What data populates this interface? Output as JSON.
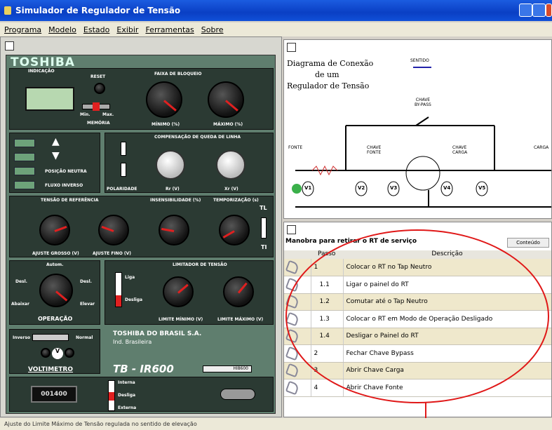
{
  "window": {
    "title": "Simulador de Regulador de Tensão"
  },
  "menu": [
    "Programa",
    "Modelo",
    "Estado",
    "Exibir",
    "Ferramentas",
    "Sobre"
  ],
  "panel": {
    "brand": "TOSHIBA",
    "indicacao": "INDICAÇÃO",
    "reset": "RESET",
    "min": "Min.",
    "max": "Max.",
    "memoria": "MEMÓRIA",
    "faixa": "FAIXA DE BLOQUEIO",
    "minimo": "MÍNIMO (%)",
    "maximo": "MÁXIMO (%)",
    "comp": "COMPENSAÇÃO DE QUEDA DE LINHA",
    "polaridade": "POLARIDADE",
    "r": "Rr (V)",
    "x": "Xr (V)",
    "posicao": "POSIÇÃO NEUTRA",
    "fluxo": "FLUXO INVERSO",
    "tensao": "TENSÃO DE REFERÊNCIA",
    "insens": "INSENSIBILIDADE (%)",
    "temp": "TEMPORIZAÇÃO (s)",
    "ajg": "AJUSTE GROSSO (V)",
    "ajf": "AJUSTE FINO (V)",
    "tl": "TL",
    "ti": "TI",
    "operacao": "OPERAÇÃO",
    "autom": "Autom.",
    "desl": "Desl.",
    "abaixar": "Abaixar",
    "elevar": "Elevar",
    "limitador": "LIMITADOR DE TENSÃO",
    "liga": "Liga",
    "desliga": "Desliga",
    "limmin": "LIMITE MÍNIMO (V)",
    "limmax": "LIMITE MÁXIMO (V)",
    "company": "TOSHIBA DO BRASIL S.A.",
    "company2": "Ind. Brasileira",
    "voltimetro": "VOLTIMETRO",
    "inverso": "Inverso",
    "normal": "Normal",
    "model": "TB - IR600",
    "display": "001400",
    "interna": "Interna",
    "desligasw": "Desliga",
    "externa": "Externa",
    "tag": "HI8600"
  },
  "diagram": {
    "title_l1": "Diagrama de Conexão",
    "title_l2": "de um",
    "title_l3": "Regulador de Tensão",
    "sentido": "SENTIDO",
    "bypass_l1": "CHAVE",
    "bypass_l2": "BY-PASS",
    "fonte": "FONTE",
    "carga": "CARGA",
    "chave_fonte": "CHAVE FONTE",
    "chave_carga": "CHAVE CARGA",
    "v1": "V1",
    "v2": "V2",
    "v3": "V3",
    "v4": "V4",
    "v5": "V5"
  },
  "procedure": {
    "title": "Manobra para retirar o RT de serviço",
    "button": "Conteúdo",
    "col_passo": "Passo",
    "col_desc": "Descrição",
    "rows": [
      {
        "passo": "1",
        "desc": "Colocar o RT no Tap Neutro"
      },
      {
        "passo": "1.1",
        "desc": "Ligar o painel do RT"
      },
      {
        "passo": "1.2",
        "desc": "Comutar até o Tap Neutro"
      },
      {
        "passo": "1.3",
        "desc": "Colocar o RT em Modo de Operação Desligado"
      },
      {
        "passo": "1.4",
        "desc": "Desligar o Painel do RT"
      },
      {
        "passo": "2",
        "desc": "Fechar Chave Bypass"
      },
      {
        "passo": "3",
        "desc": "Abrir Chave Carga"
      },
      {
        "passo": "4",
        "desc": "Abrir Chave Fonte"
      }
    ]
  },
  "status": "Ajuste do Limite Máximo de Tensão regulada no sentido de elevação"
}
